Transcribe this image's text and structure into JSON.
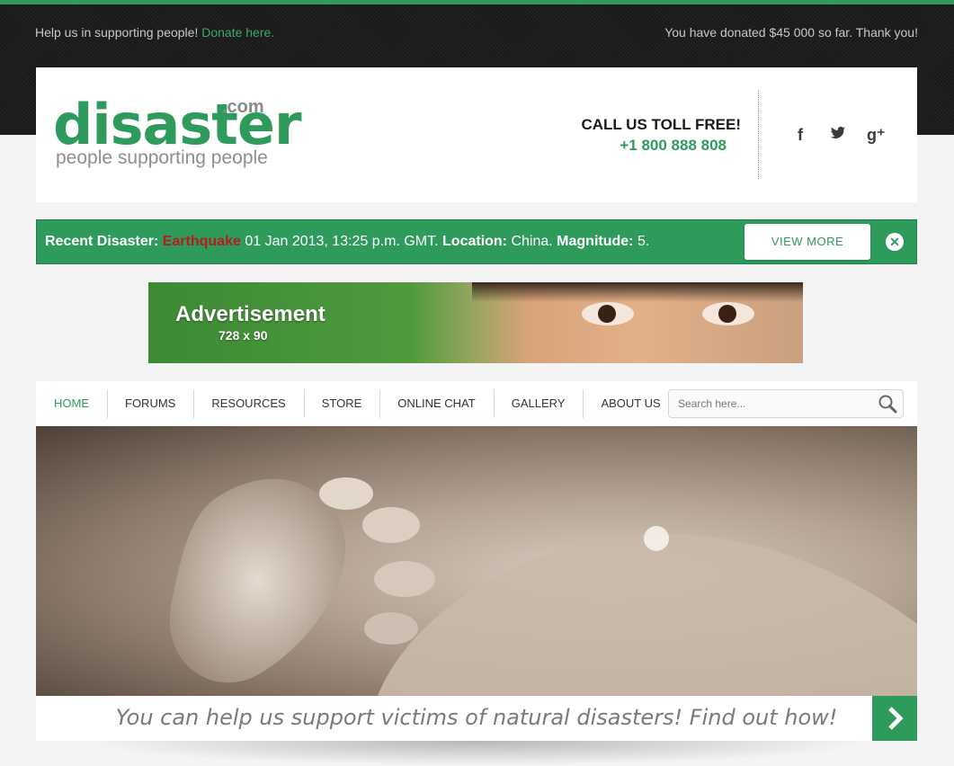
{
  "topbar": {
    "help_text": "Help us in supporting people!",
    "donate_link": "Donate here.",
    "donated_text": "You have donated $45 000 so far. Thank you!"
  },
  "logo": {
    "name": "disaster",
    "tld": ".com",
    "tagline": "people supporting people"
  },
  "contact": {
    "heading": "CALL US TOLL FREE!",
    "phone": "+1 800 888 808"
  },
  "social": [
    {
      "icon": "facebook-icon",
      "glyph": "f"
    },
    {
      "icon": "twitter-icon",
      "glyph": "t"
    },
    {
      "icon": "google-plus-icon",
      "glyph": "g⁺"
    }
  ],
  "alert": {
    "label": "Recent Disaster:",
    "type": "Earthquake",
    "date": "01 Jan 2013, 13:25 p.m. GMT.",
    "location_label": "Location:",
    "location": "China.",
    "magnitude_label": "Magnitude:",
    "magnitude": "5.",
    "view_more": "VIEW MORE",
    "close_glyph": "✕"
  },
  "ad": {
    "title": "Advertisement",
    "size": "728 x 90"
  },
  "nav": {
    "items": [
      "HOME",
      "FORUMS",
      "RESOURCES",
      "STORE",
      "ONLINE CHAT",
      "GALLERY",
      "ABOUT US"
    ],
    "active_index": 0
  },
  "search": {
    "placeholder": "Search here..."
  },
  "slider": {
    "caption": "You can help us support victims of natural disasters! Find out how!",
    "prev_icon": "chevron-left-icon",
    "next_icon": "chevron-right-icon"
  },
  "colors": {
    "accent": "#2e9a5c",
    "alert_type": "#b71c1c"
  }
}
